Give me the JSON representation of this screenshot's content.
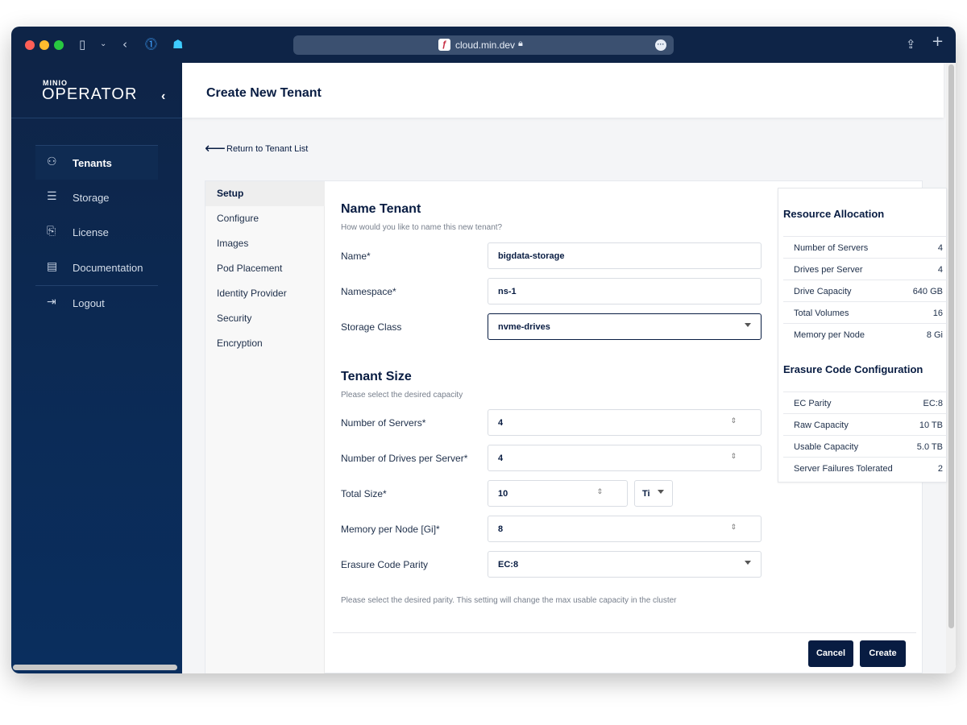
{
  "browser": {
    "url": "cloud.min.dev",
    "tab_icons": [
      "sidebar-toggle-icon",
      "chevron-down-icon",
      "back-icon",
      "password-manager-icon",
      "ghost-extension-icon"
    ],
    "share_icon": "⇪",
    "new_tab_icon": "+"
  },
  "sidebar": {
    "logo_small": "MINIO",
    "logo_big": "OPERATOR",
    "collapse_icon": "‹",
    "items": [
      {
        "label": "Tenants",
        "icon": "⚇",
        "active": true
      },
      {
        "label": "Storage",
        "icon": "☰",
        "active": false
      },
      {
        "label": "License",
        "icon": "⎘",
        "active": false
      },
      {
        "label": "Documentation",
        "icon": "▤",
        "active": false
      },
      {
        "label": "Logout",
        "icon": "⇥",
        "active": false
      }
    ]
  },
  "header": {
    "title": "Create New Tenant"
  },
  "back_link": {
    "arrow": "⟵",
    "label": "Return to Tenant List"
  },
  "steps": [
    "Setup",
    "Configure",
    "Images",
    "Pod Placement",
    "Identity Provider",
    "Security",
    "Encryption"
  ],
  "name_tenant": {
    "title": "Name Tenant",
    "subtitle": "How would you like to name this new tenant?",
    "fields": [
      {
        "label": "Name*",
        "value": "bigdata-storage"
      },
      {
        "label": "Namespace*",
        "value": "ns-1"
      },
      {
        "label": "Storage Class",
        "value": "nvme-drives"
      }
    ]
  },
  "tenant_size": {
    "title": "Tenant Size",
    "subtitle": "Please select the desired capacity",
    "fields": [
      {
        "label": "Number of Servers*",
        "value": "4"
      },
      {
        "label": "Number of Drives per Server*",
        "value": "4"
      },
      {
        "label": "Total Size*",
        "value": "10",
        "unit": "Ti"
      },
      {
        "label": "Memory per Node [Gi]*",
        "value": "8"
      },
      {
        "label": "Erasure Code Parity",
        "value": "EC:8"
      }
    ],
    "note": "Please select the desired parity. This setting will change the max usable capacity in the cluster"
  },
  "resource_allocation": {
    "title": "Resource Allocation",
    "rows": [
      {
        "key": "Number of Servers",
        "value": "4"
      },
      {
        "key": "Drives per Server",
        "value": "4"
      },
      {
        "key": "Drive Capacity",
        "value": "640 GB"
      },
      {
        "key": "Total Volumes",
        "value": "16"
      },
      {
        "key": "Memory per Node",
        "value": "8 Gi"
      }
    ]
  },
  "erasure_config": {
    "title": "Erasure Code Configuration",
    "rows": [
      {
        "key": "EC Parity",
        "value": "EC:8"
      },
      {
        "key": "Raw Capacity",
        "value": "10 TB"
      },
      {
        "key": "Usable Capacity",
        "value": "5.0 TB"
      },
      {
        "key": "Server Failures Tolerated",
        "value": "2"
      }
    ]
  },
  "buttons": {
    "cancel": "Cancel",
    "create": "Create"
  },
  "colors": {
    "sidebar": "#0e2447",
    "primary": "#081c42",
    "background": "#f4f5f7"
  }
}
